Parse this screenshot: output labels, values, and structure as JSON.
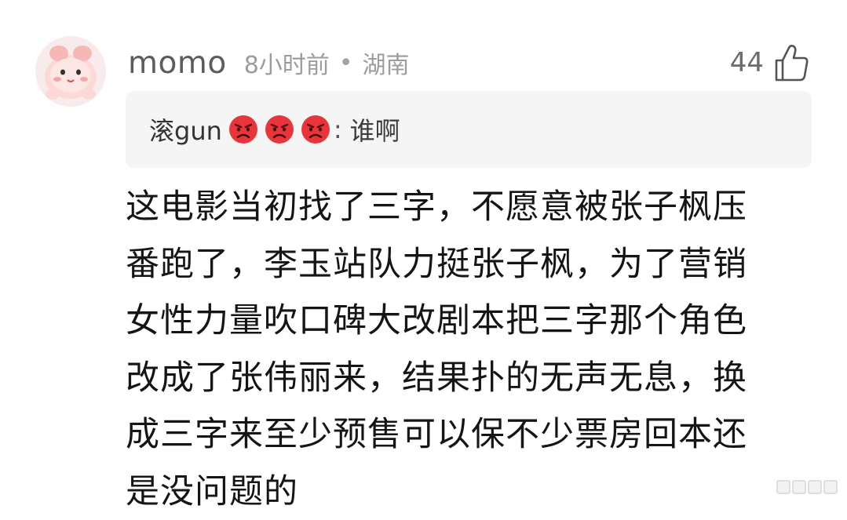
{
  "comment": {
    "username": "momo",
    "time": "8小时前",
    "separator": "•",
    "location": "湖南",
    "like_count": "44",
    "like_icon": "thumbs-up-icon",
    "avatar_icon": "cartoon-avatar",
    "quoted_reply": {
      "name": "滚gun",
      "emoji_icon": "angry-face-icon",
      "colon": ":",
      "text": "谁啊"
    },
    "body_lines": [
      "这电影当初找了三字，不愿意被张子枫压",
      "番跑了，李玉站队力挺张子枫，为了营销",
      "女性力量吹口碑大改剧本把三字那个角色",
      "改成了张伟丽来，结果扑的无声无息，换",
      "成三字来至少预售可以保不少票房回本还",
      "是没问题的"
    ]
  },
  "colors": {
    "username": "#5c5c5c",
    "meta": "#9c9c9c",
    "quote_bg": "#f5f5f5",
    "angry_emoji": "#e8353b",
    "body_text": "#151515"
  }
}
